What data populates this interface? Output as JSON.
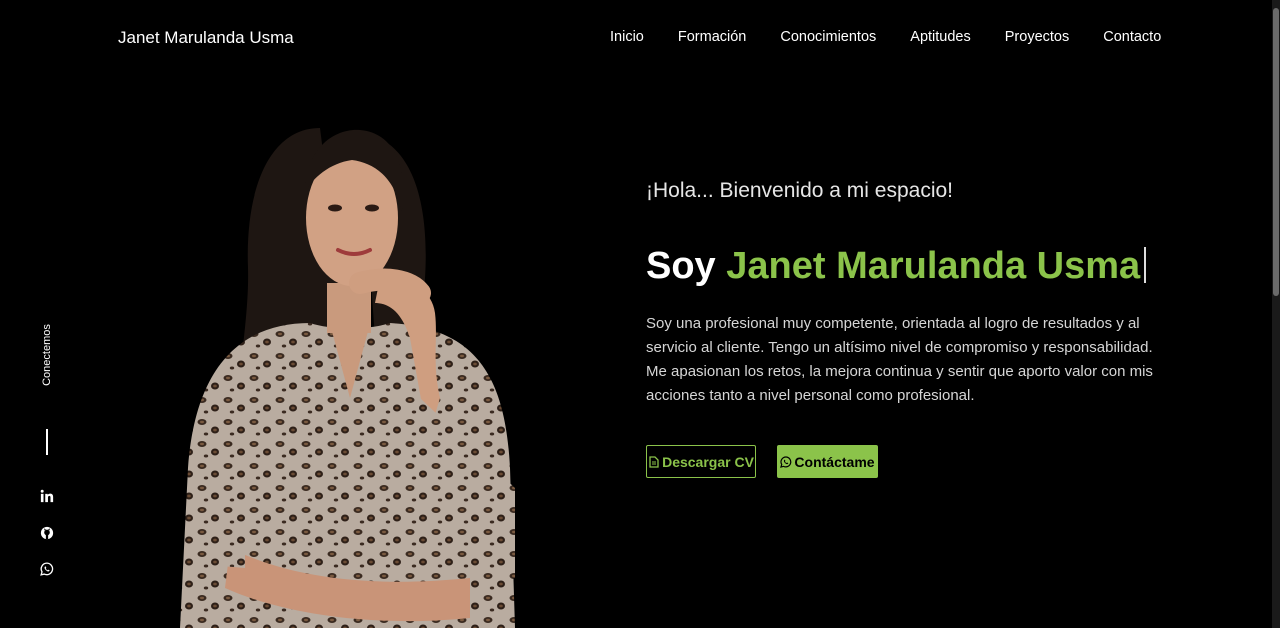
{
  "brand": "Janet Marulanda Usma",
  "nav": [
    "Inicio",
    "Formación",
    "Conocimientos",
    "Aptitudes",
    "Proyectos",
    "Contacto"
  ],
  "sidebar": {
    "label": "Conectemos",
    "icons": [
      "linkedin-icon",
      "github-icon",
      "whatsapp-icon"
    ]
  },
  "hero": {
    "greeting": "¡Hola... Bienvenido a mi espacio!",
    "title_prefix": "Soy",
    "title_name": "Janet Marulanda Usma",
    "description": "Soy una profesional muy competente, orientada al logro de resultados y al servicio al cliente. Tengo un altísimo nivel de compromiso y responsabilidad. Me apasionan los retos, la mejora continua y sentir que aporto valor con mis acciones tanto a nivel personal como profesional.",
    "btn_cv": "Descargar CV",
    "btn_contact": "Contáctame"
  },
  "colors": {
    "accent": "#8bc34a",
    "background": "#000000"
  }
}
